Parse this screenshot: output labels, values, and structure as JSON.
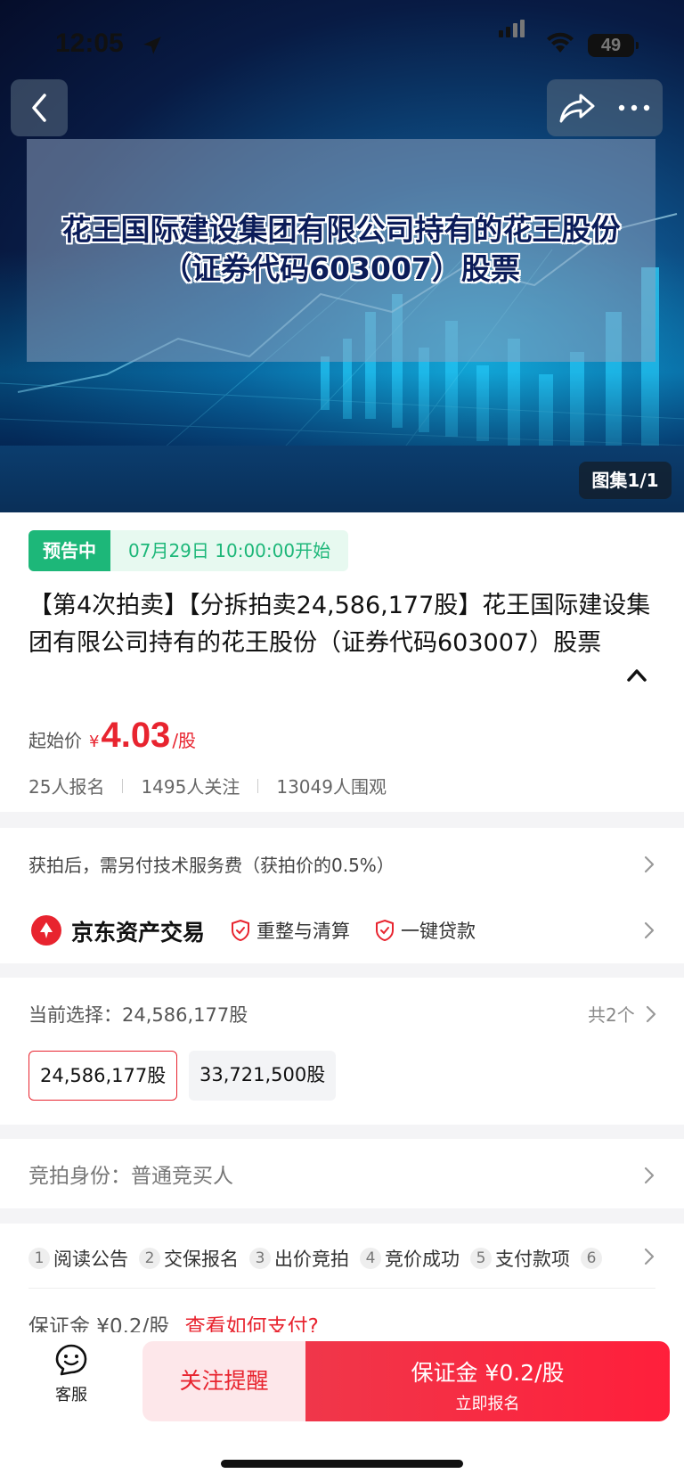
{
  "status_bar": {
    "time": "12:05",
    "battery": "49"
  },
  "hero": {
    "title_text": "花王国际建设集团有限公司持有的花王股份（证券代码603007）股票",
    "gallery_badge": "图集1/1"
  },
  "lot": {
    "status_tag": "预告中",
    "start_time": "07月29日 10:00:00开始",
    "title": "【第4次拍卖】【分拆拍卖24,586,177股】花王国际建设集团有限公司持有的花王股份（证券代码603007）股票",
    "price_label": "起始价",
    "price_currency": "¥",
    "price_value": "4.03",
    "price_unit": "/股",
    "stats": {
      "registered": "25人报名",
      "followers": "1495人关注",
      "viewers": "13049人围观"
    }
  },
  "fee": {
    "note": "获拍后，需另付技术服务费（获拍价的0.5%）",
    "platform_name": "京东资产交易",
    "tags": [
      "重整与清算",
      "一键贷款"
    ]
  },
  "selection": {
    "label": "当前选择：24,586,177股",
    "count": "共2个",
    "options": [
      "24,586,177股",
      "33,721,500股"
    ]
  },
  "identity": {
    "text": "竞拍身份：普通竞买人"
  },
  "steps": {
    "items": [
      {
        "num": "1",
        "label": "阅读公告"
      },
      {
        "num": "2",
        "label": "交保报名"
      },
      {
        "num": "3",
        "label": "出价竞拍"
      },
      {
        "num": "4",
        "label": "竞价成功"
      },
      {
        "num": "5",
        "label": "支付款项"
      },
      {
        "num": "6",
        "label": ""
      }
    ],
    "deposit_text": "保证金 ¥0.2/股",
    "deposit_link": "查看如何支付?"
  },
  "bottom_bar": {
    "service_label": "客服",
    "follow_label": "关注提醒",
    "signup_main": "保证金 ¥0.2/股",
    "signup_sub": "立即报名"
  },
  "colors": {
    "accent_red": "#e8242f",
    "status_green": "#1db779"
  }
}
